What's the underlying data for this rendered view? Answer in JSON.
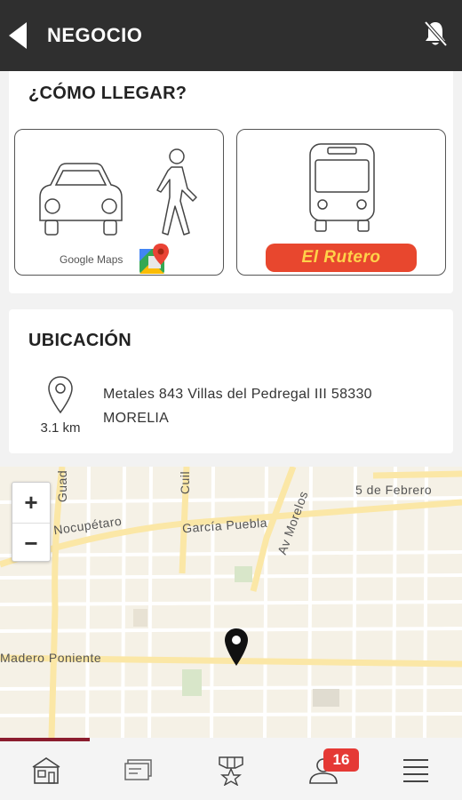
{
  "header": {
    "title": "NEGOCIO",
    "back_icon": "back-arrow-icon",
    "notification_icon": "bell-off-icon",
    "background": "#2f2f2f"
  },
  "como_llegar": {
    "title": "¿CÓMO LLEGAR?",
    "google_maps": {
      "label": "Google Maps",
      "icons": [
        "car-icon",
        "walking-person-icon",
        "google-maps-logo-icon"
      ]
    },
    "rutero": {
      "logo_text": "El Rutero",
      "icons": [
        "bus-icon"
      ],
      "color": "#e8472e"
    }
  },
  "ubicacion": {
    "title": "UBICACIÓN",
    "distance": "3.1 km",
    "address_line1": "Metales 843 Villas del Pedregal III 58330",
    "address_line2": "MORELIA"
  },
  "map": {
    "zoom_in": "+",
    "zoom_out": "−",
    "streets": [
      "Nocupétaro",
      "García Puebla",
      "Av Morelos",
      "5 de Febrero",
      "Madero Poniente",
      "Guad",
      "Cuil"
    ]
  },
  "bottom_nav": {
    "items": [
      "home-icon",
      "tickets-icon",
      "rewards-medal-icon",
      "profile-icon",
      "menu-icon"
    ],
    "active_index": 0,
    "profile_badge": "16",
    "accent": "#8b1d2e"
  }
}
